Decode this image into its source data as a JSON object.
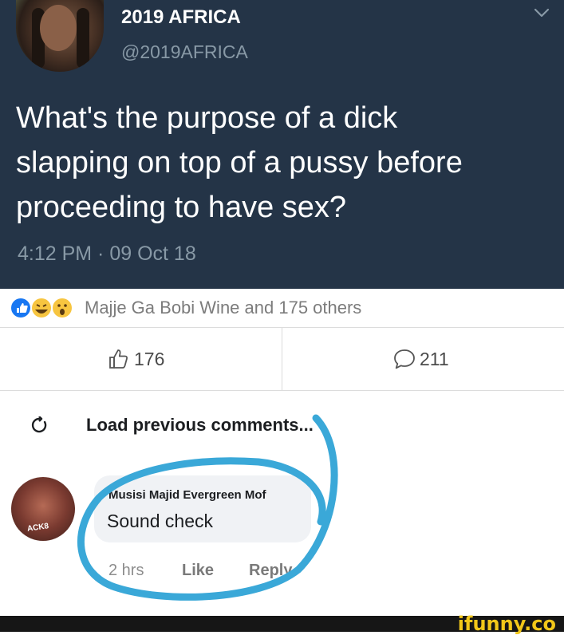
{
  "tweet": {
    "display_name": "2019 AFRICA",
    "handle": "@2019AFRICA",
    "text": "What's the purpose of a dick\nslapping on top of a pussy before\nproceeding to have sex?",
    "timestamp": "4:12 PM · 09 Oct 18"
  },
  "facebook": {
    "reactions_text": "Majje Ga Bobi Wine and 175 others",
    "like_count": "176",
    "comment_count": "211",
    "load_previous": "Load previous comments...",
    "comment": {
      "author": "Musisi Majid Evergreen Mof",
      "text": "Sound check",
      "time": "2 hrs",
      "like_label": "Like",
      "reply_label": "Reply"
    },
    "colors": {
      "tweet_bg": "#243447",
      "annotation_circle": "#3aa8d8",
      "like_blue": "#1877f2"
    }
  },
  "footer": {
    "logo": "ifunny.co"
  }
}
